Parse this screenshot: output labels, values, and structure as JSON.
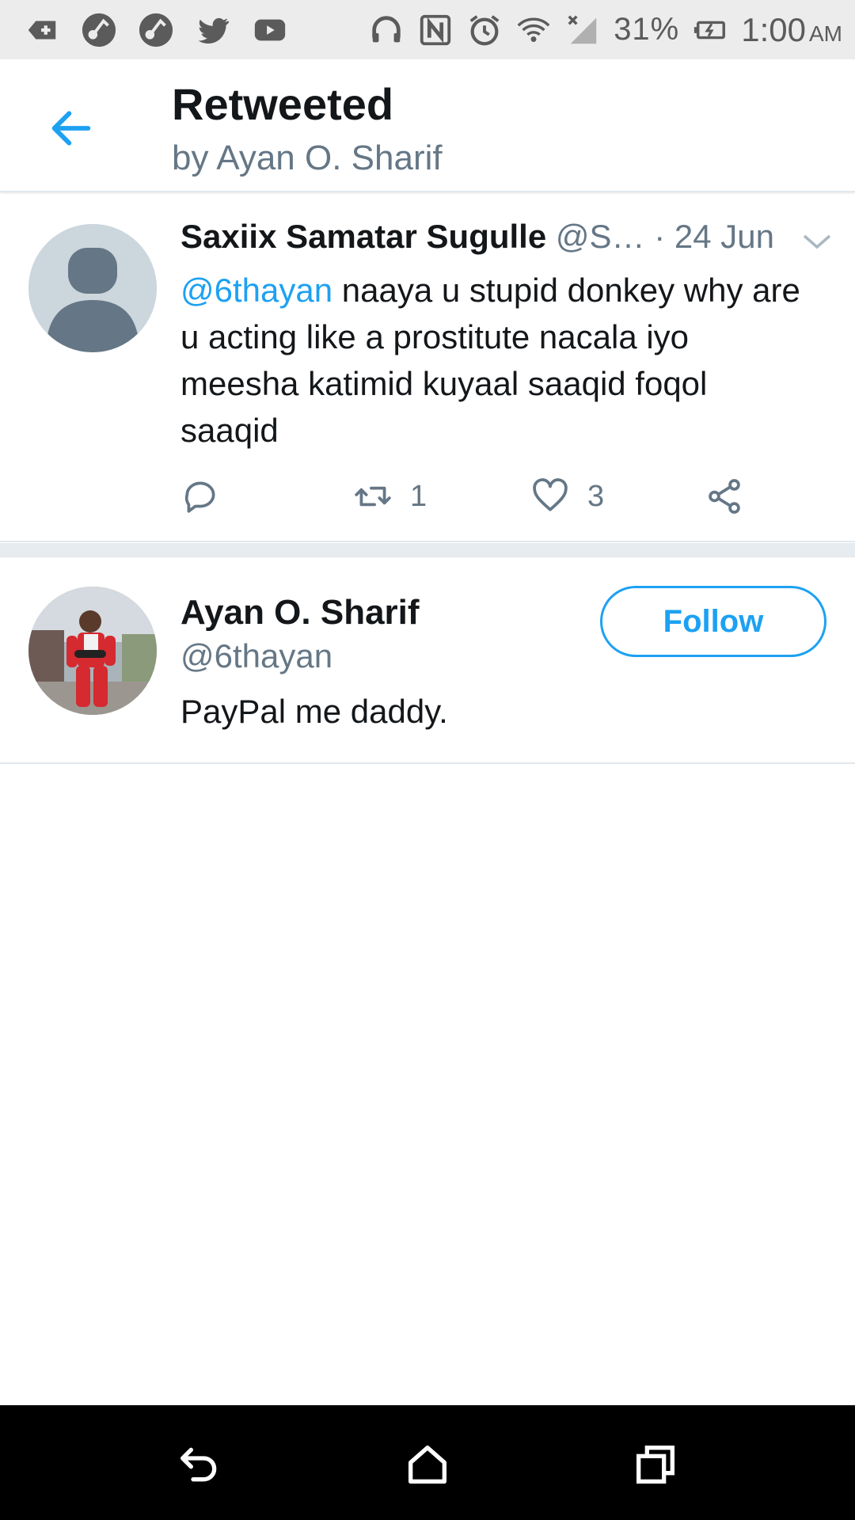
{
  "status_bar": {
    "battery": "31%",
    "time": "1:00",
    "ampm": "AM",
    "icons": [
      "add-box-icon",
      "app-icon",
      "app-icon",
      "twitter-icon",
      "youtube-icon",
      "headphones-icon",
      "nfc-icon",
      "alarm-icon",
      "wifi-icon",
      "signal-icon",
      "battery-charging-icon"
    ]
  },
  "header": {
    "title": "Retweeted",
    "subtitle": "by Ayan O. Sharif"
  },
  "tweet": {
    "name": "Saxiix Samatar Sugulle",
    "handle": "@S…",
    "date": " · 24 Jun",
    "mention": "@6thayan",
    "text": " naaya u stupid donkey why are u acting like a prostitute nacala iyo meesha katimid kuyaal saaqid foqol saaqid",
    "retweet_count": "1",
    "like_count": "3"
  },
  "user": {
    "name": "Ayan O. Sharif",
    "handle": "@6thayan",
    "bio": "PayPal me daddy.",
    "follow_label": "Follow"
  },
  "colors": {
    "accent": "#1da1f2",
    "secondary_text": "#657786",
    "primary_text": "#14171a",
    "divider": "#e6ecf0"
  }
}
